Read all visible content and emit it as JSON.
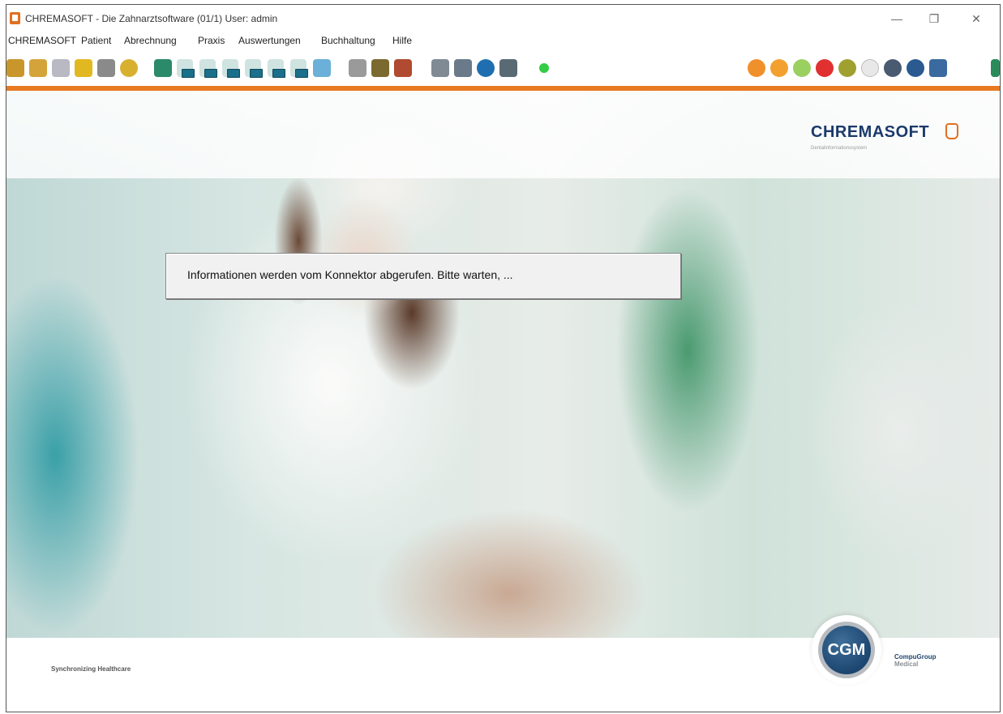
{
  "window": {
    "title": "CHREMASOFT - Die Zahnarztsoftware (01/1) User: admin",
    "minimize_glyph": "—",
    "restore_glyph": "❐",
    "close_glyph": "✕"
  },
  "menu": [
    {
      "label": "CHREMASOFT"
    },
    {
      "label": "Patient"
    },
    {
      "label": "Abrechnung"
    },
    {
      "label": "Praxis"
    },
    {
      "label": "Auswertungen"
    },
    {
      "label": "Buchhaltung"
    },
    {
      "label": "Hilfe"
    }
  ],
  "toolbar": {
    "icons": [
      "patient-card-icon",
      "group-icon",
      "tooth-icon",
      "puzzle-icon",
      "cash-icon",
      "alarm-clock-icon",
      "dental-chair-icon",
      "doc-ze-icon",
      "doc-kc-icon",
      "doc-ip-icon",
      "doc-kb-icon",
      "doc-pa-icon",
      "doc-kfo-icon",
      "lab-flask-icon",
      "scanner-icon",
      "book-icon",
      "boot-icon",
      "printer-icon",
      "pen-icon",
      "globe-net-icon",
      "xray-icon",
      "status-dot-icon",
      "orange-check-icon",
      "orange-ring-icon",
      "green-ring-icon",
      "red-heart-icon",
      "purple-chart-icon",
      "e-service-icon",
      "swirl-icon",
      "cgm-life-icon",
      "shop-cart-icon"
    ],
    "status_color": "#33cc44",
    "accent_color": "#e87a22"
  },
  "branding": {
    "product": "CHREMASOFT",
    "tagline": "Dentalinformationssystem",
    "footer_tagline": "Synchronizing Healthcare",
    "cgm_abbr": "CGM",
    "company_line1": "CompuGroup",
    "company_line2": "Medical"
  },
  "dialog": {
    "message": "Informationen werden vom Konnektor abgerufen. Bitte warten, ..."
  }
}
